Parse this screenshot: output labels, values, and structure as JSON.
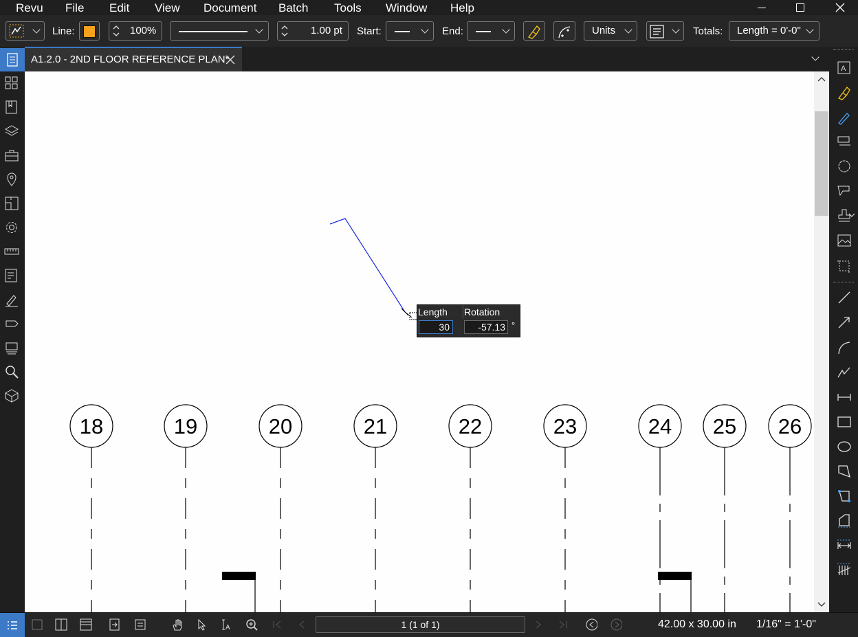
{
  "menu": [
    "Revu",
    "File",
    "Edit",
    "View",
    "Document",
    "Batch",
    "Tools",
    "Window",
    "Help"
  ],
  "toolbar": {
    "line_label": "Line:",
    "line_color": "#f7a21b",
    "opacity": "100%",
    "line_width": "1.00 pt",
    "start_label": "Start:",
    "end_label": "End:",
    "units": "Units",
    "totals_label": "Totals:",
    "totals_value": "Length = 0'-0\""
  },
  "tab": {
    "title": "A1.2.0 - 2ND FLOOR REFERENCE PLAN*"
  },
  "popup": {
    "length_label": "Length",
    "rotation_label": "Rotation",
    "length_value": "30",
    "rotation_value": "-57.13",
    "degree": "°"
  },
  "gridlines": [
    "18",
    "19",
    "20",
    "21",
    "22",
    "23",
    "24",
    "25",
    "26"
  ],
  "status": {
    "page": "1 (1 of 1)",
    "size": "42.00 x 30.00 in",
    "scale": "1/16\" = 1'-0\""
  },
  "colors": {
    "accent": "#3c7ac8",
    "markup_line": "#1a2be0"
  }
}
